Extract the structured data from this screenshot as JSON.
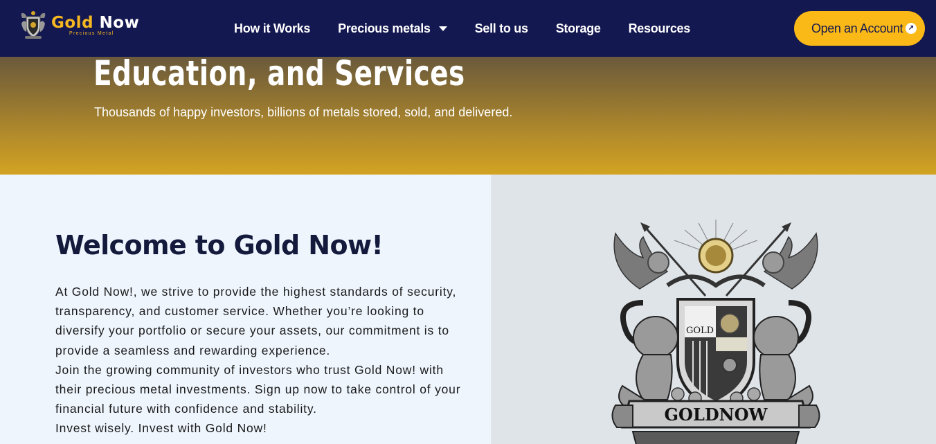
{
  "header": {
    "logo": {
      "word1": "Gold",
      "word2": "Now",
      "tagline": "Precious Metal"
    },
    "nav": [
      {
        "label": "How it Works"
      },
      {
        "label": "Precious metals",
        "has_dropdown": true
      },
      {
        "label": "Sell to us"
      },
      {
        "label": "Storage"
      },
      {
        "label": "Resources"
      }
    ],
    "cta_label": "Open an Account",
    "cta_icon": "arrow-up-right-icon"
  },
  "hero": {
    "title": "Education, and Services",
    "subtitle": "Thousands of happy investors, billions of metals stored, sold, and delivered."
  },
  "welcome": {
    "title": "Welcome to Gold Now!",
    "lines": [
      "At Gold Now!, we strive to provide the highest standards of security,",
      "transparency, and customer service. Whether you’re looking to",
      "diversify your portfolio or secure your assets, our commitment is to",
      "provide a seamless and rewarding experience.",
      "Join the growing community of investors who trust Gold Now! with",
      "their precious metal investments. Sign up now to take control of your",
      "financial future with confidence and stability.",
      "Invest wisely. Invest with Gold Now!"
    ]
  },
  "crest": {
    "shield_text": "GOLD",
    "banner_text": "GOLDNOW"
  },
  "colors": {
    "nav_bg": "#141850",
    "accent": "#fbb917",
    "hero_top": "#6a5a3c",
    "hero_bottom": "#d2a322",
    "left_bg": "#eef5fd",
    "right_bg": "#dfe4e9"
  }
}
